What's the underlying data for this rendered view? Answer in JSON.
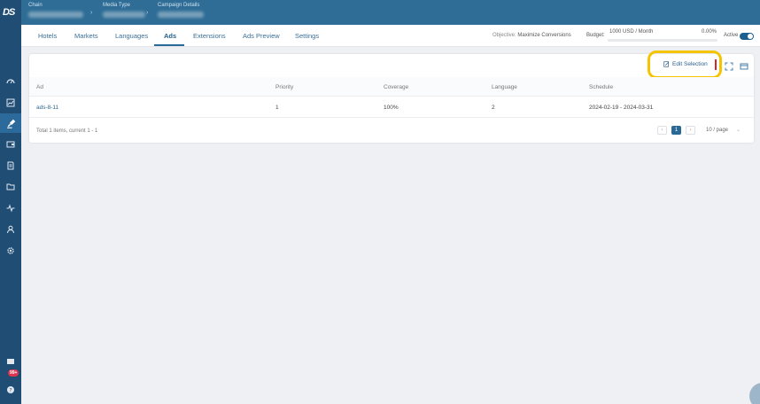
{
  "logo_text": "DS",
  "notification_count": "99+",
  "breadcrumb": [
    {
      "label": "Chain"
    },
    {
      "label": "Media Type"
    },
    {
      "label": "Campaign Details"
    }
  ],
  "tabs": [
    {
      "label": "Hotels"
    },
    {
      "label": "Markets"
    },
    {
      "label": "Languages"
    },
    {
      "label": "Ads"
    },
    {
      "label": "Extensions"
    },
    {
      "label": "Ads Preview"
    },
    {
      "label": "Settings"
    }
  ],
  "objective": {
    "label": "Objective:",
    "value": "Maximize Conversions"
  },
  "budget": {
    "label": "Budget:",
    "value": "1000 USD / Month",
    "percent_text": "0.00%",
    "spent_fraction": 0.0
  },
  "status": {
    "label": "Active",
    "on": true
  },
  "toolbar": {
    "edit_selection_label": "Edit Selection"
  },
  "table": {
    "columns": [
      "Ad",
      "Priority",
      "Coverage",
      "Language",
      "Schedule"
    ],
    "rows": [
      {
        "ad": "ads-8-11",
        "priority": "1",
        "coverage": "100%",
        "language": "2",
        "schedule": "2024-02-19 - 2024-03-31"
      }
    ]
  },
  "pagination": {
    "total_text": "Total 1 items, current 1 - 1",
    "current_page": "1",
    "page_size": "10 / page"
  },
  "colors": {
    "sidebar": "#1f4d74",
    "header": "#2f6d96",
    "accent": "#2a6896",
    "highlight": "#f5c400"
  },
  "sidebar_icons": [
    "dashboard-icon",
    "chart-icon",
    "gavel-icon",
    "wallet-icon",
    "report-icon",
    "folder-icon",
    "activity-icon",
    "user-icon",
    "gear-icon",
    "news-icon",
    "help-icon"
  ]
}
